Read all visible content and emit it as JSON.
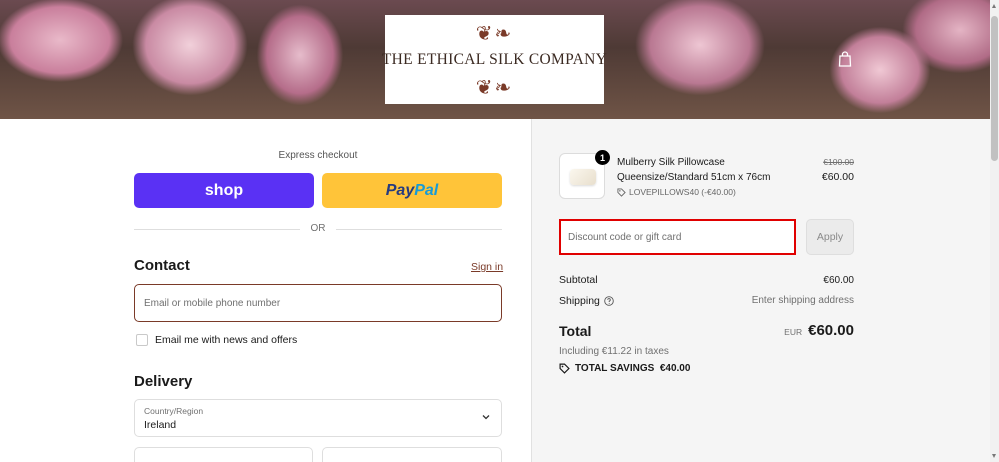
{
  "header": {
    "brand_name": "THE ETHICAL SILK COMPANY",
    "cart_icon": "shopping-bag-icon"
  },
  "express_checkout": {
    "label": "Express checkout",
    "shop_pay_label": "shop",
    "paypal_pay": "Pay",
    "paypal_pal": "Pal",
    "or_divider": "OR"
  },
  "contact": {
    "heading": "Contact",
    "sign_in": "Sign in",
    "email_placeholder": "Email or mobile phone number",
    "email_value": "",
    "newsletter_label": "Email me with news and offers",
    "newsletter_checked": false
  },
  "delivery": {
    "heading": "Delivery",
    "country_label": "Country/Region",
    "country_value": "Ireland"
  },
  "order_summary": {
    "item": {
      "quantity": "1",
      "name": "Mulberry Silk Pillowcase",
      "variant": "Queensize/Standard 51cm x 76cm",
      "discount": "LOVEPILLOWS40 (-€40.00)",
      "original_price": "€100.00",
      "price": "€60.00"
    },
    "discount_placeholder": "Discount code or gift card",
    "apply_label": "Apply",
    "subtotal_label": "Subtotal",
    "subtotal_value": "€60.00",
    "shipping_label": "Shipping",
    "shipping_value": "Enter shipping address",
    "total_label": "Total",
    "currency": "EUR",
    "total_value": "€60.00",
    "taxes": "Including €11.22 in taxes",
    "savings": "TOTAL SAVINGS  €40.00"
  },
  "colors": {
    "accent": "#7a3a28",
    "shop_pay": "#5a31f4",
    "paypal": "#ffc439",
    "highlight": "#e00000"
  }
}
